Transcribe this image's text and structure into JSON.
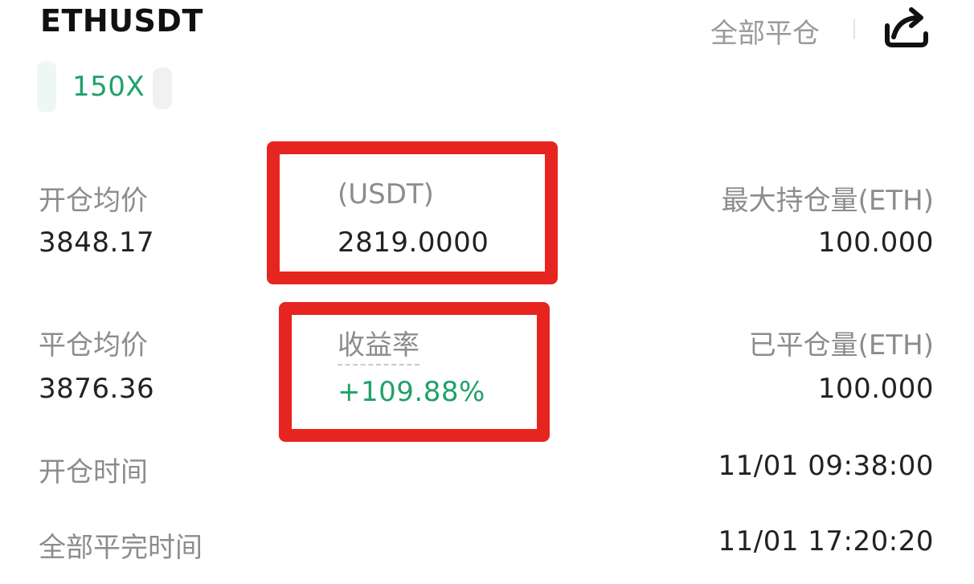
{
  "header": {
    "symbol": "ETHUSDT",
    "close_all_label": "全部平仓",
    "leverage": "150X"
  },
  "row1": {
    "open_avg_price_label": "开仓均价",
    "open_avg_price_value": "3848.17",
    "middle_label": "(USDT)",
    "middle_value": "2819.0000",
    "max_position_label": "最大持仓量(ETH)",
    "max_position_value": "100.000"
  },
  "row2": {
    "close_avg_price_label": "平仓均价",
    "close_avg_price_value": "3876.36",
    "roi_label": "收益率",
    "roi_value": "+109.88%",
    "closed_qty_label": "已平仓量(ETH)",
    "closed_qty_value": "100.000"
  },
  "row3": {
    "open_time_label": "开仓时间",
    "open_time_value": "11/01 09:38:00"
  },
  "row4": {
    "full_close_time_label": "全部平完时间",
    "full_close_time_value": "11/01 17:20:20"
  },
  "colors": {
    "profit_green": "#1fa26a",
    "label_gray": "#8c8c8c",
    "highlight_red": "#e62521"
  },
  "icons": {
    "share": "share-icon"
  }
}
